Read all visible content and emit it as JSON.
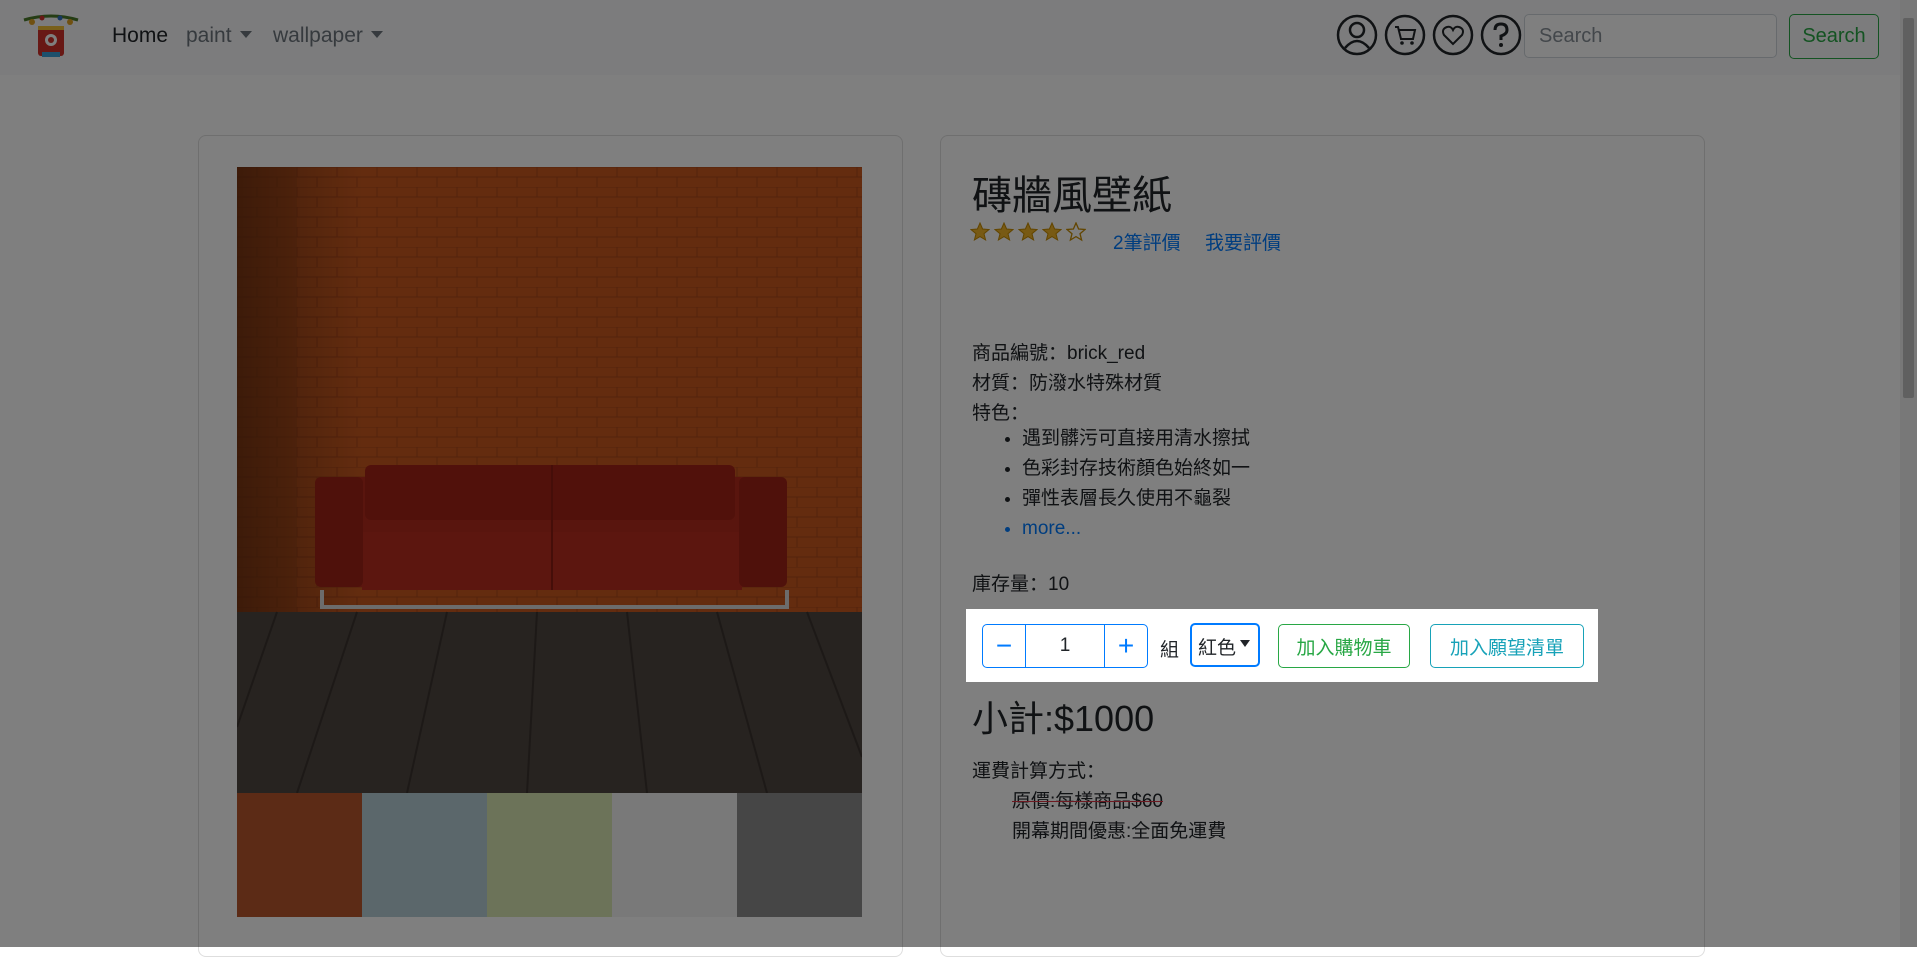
{
  "nav": {
    "home": "Home",
    "paint": "paint",
    "wallpaper": "wallpaper",
    "search_placeholder": "Search",
    "search_button": "Search"
  },
  "product": {
    "title": "磚牆風壁紙",
    "rating": 4,
    "rating_max": 5,
    "reviews_link": "2筆評價",
    "write_review_link": "我要評價",
    "code_line": "商品編號：brick_red",
    "material_line": "材質：防潑水特殊材質",
    "features_label": "特色：",
    "features": [
      "遇到髒污可直接用清水擦拭",
      "色彩封存技術顏色始終如一",
      "彈性表層長久使用不龜裂"
    ],
    "more_link": "more...",
    "stock_line": "庫存量：10"
  },
  "order": {
    "quantity": "1",
    "minus": "−",
    "plus": "+",
    "unit": "組",
    "color": "紅色",
    "add_to_cart": "加入購物車",
    "add_to_wishlist": "加入願望清單"
  },
  "subtotal": "小計:$1000",
  "shipping": {
    "label": "運費計算方式：",
    "original": "原價:每樣商品$60",
    "promo": "開幕期間優惠:全面免運費"
  },
  "colors": {
    "brand_green": "#28a745",
    "primary_blue": "#007bff",
    "info_teal": "#17a2b8",
    "brick": "#c8591f"
  },
  "thumbnail_swatches": [
    "#b9572c",
    "#b7cfd6",
    "#d9e6b2",
    "#f2f2f2",
    "#8c8c8c"
  ]
}
